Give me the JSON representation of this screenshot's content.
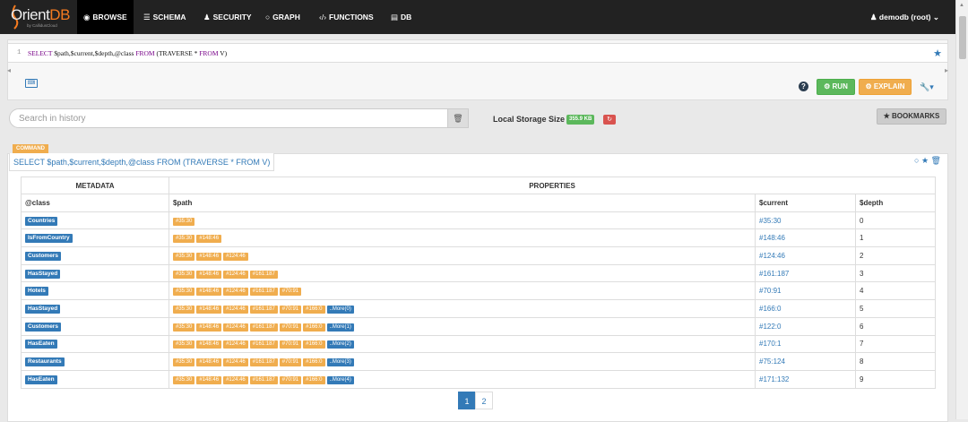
{
  "brand": {
    "name_a": "Orient",
    "name_b": "DB",
    "tagline": "by CallidusCloud"
  },
  "nav": {
    "items": [
      {
        "label": "BROWSE",
        "icon": "eye-icon"
      },
      {
        "label": "SCHEMA",
        "icon": "list-icon"
      },
      {
        "label": "SECURITY",
        "icon": "user-icon"
      },
      {
        "label": "GRAPH",
        "icon": "circle-icon"
      },
      {
        "label": "FUNCTIONS",
        "icon": "code-icon"
      },
      {
        "label": "DB",
        "icon": "database-icon"
      }
    ],
    "user": "demodb (root)"
  },
  "editor": {
    "line_number": "1",
    "query_kw1": "SELECT",
    "query_mid": " $path,$current,$depth,@class ",
    "query_kw2": "FROM",
    "query_mid2": " (TRAVERSE * ",
    "query_kw3": "FROM",
    "query_end": " V)"
  },
  "toolbar": {
    "run_label": "RUN",
    "explain_label": "EXPLAIN"
  },
  "history": {
    "placeholder": "Search in history",
    "storage_label": "Local Storage Size",
    "storage_size": "355.9 KB",
    "bookmarks_label": "BOOKMARKS"
  },
  "command": {
    "tag": "COMMAND",
    "query": "SELECT $path,$current,$depth,@class FROM (TRAVERSE * FROM V)"
  },
  "table": {
    "group_headers": [
      "METADATA",
      "PROPERTIES"
    ],
    "columns": [
      "@class",
      "$path",
      "$current",
      "$depth"
    ],
    "rows": [
      {
        "class": "Countries",
        "path": [
          "#35:30"
        ],
        "more": "",
        "current": "#35:30",
        "depth": "0"
      },
      {
        "class": "IsFromCountry",
        "path": [
          "#35:30",
          "#148:46"
        ],
        "more": "",
        "current": "#148:46",
        "depth": "1"
      },
      {
        "class": "Customers",
        "path": [
          "#35:30",
          "#148:46",
          "#124:46"
        ],
        "more": "",
        "current": "#124:46",
        "depth": "2"
      },
      {
        "class": "HasStayed",
        "path": [
          "#35:30",
          "#148:46",
          "#124:46",
          "#161:187"
        ],
        "more": "",
        "current": "#161:187",
        "depth": "3"
      },
      {
        "class": "Hotels",
        "path": [
          "#35:30",
          "#148:46",
          "#124:46",
          "#161:187",
          "#70:91"
        ],
        "more": "",
        "current": "#70:91",
        "depth": "4"
      },
      {
        "class": "HasStayed",
        "path": [
          "#35:30",
          "#148:46",
          "#124:46",
          "#161:187",
          "#70:91",
          "#166:0"
        ],
        "more": "..More(0)",
        "current": "#166:0",
        "depth": "5"
      },
      {
        "class": "Customers",
        "path": [
          "#35:30",
          "#148:46",
          "#124:46",
          "#161:187",
          "#70:91",
          "#166:0"
        ],
        "more": "..More(1)",
        "current": "#122:0",
        "depth": "6"
      },
      {
        "class": "HasEaten",
        "path": [
          "#35:30",
          "#148:46",
          "#124:46",
          "#161:187",
          "#70:91",
          "#166:0"
        ],
        "more": "..More(2)",
        "current": "#170:1",
        "depth": "7"
      },
      {
        "class": "Restaurants",
        "path": [
          "#35:30",
          "#148:46",
          "#124:46",
          "#161:187",
          "#70:91",
          "#166:0"
        ],
        "more": "..More(3)",
        "current": "#75:124",
        "depth": "8"
      },
      {
        "class": "HasEaten",
        "path": [
          "#35:30",
          "#148:46",
          "#124:46",
          "#161:187",
          "#70:91",
          "#166:0"
        ],
        "more": "..More(4)",
        "current": "#171:132",
        "depth": "9"
      }
    ]
  },
  "pagination": {
    "pages": [
      "1",
      "2"
    ],
    "active": "1"
  }
}
